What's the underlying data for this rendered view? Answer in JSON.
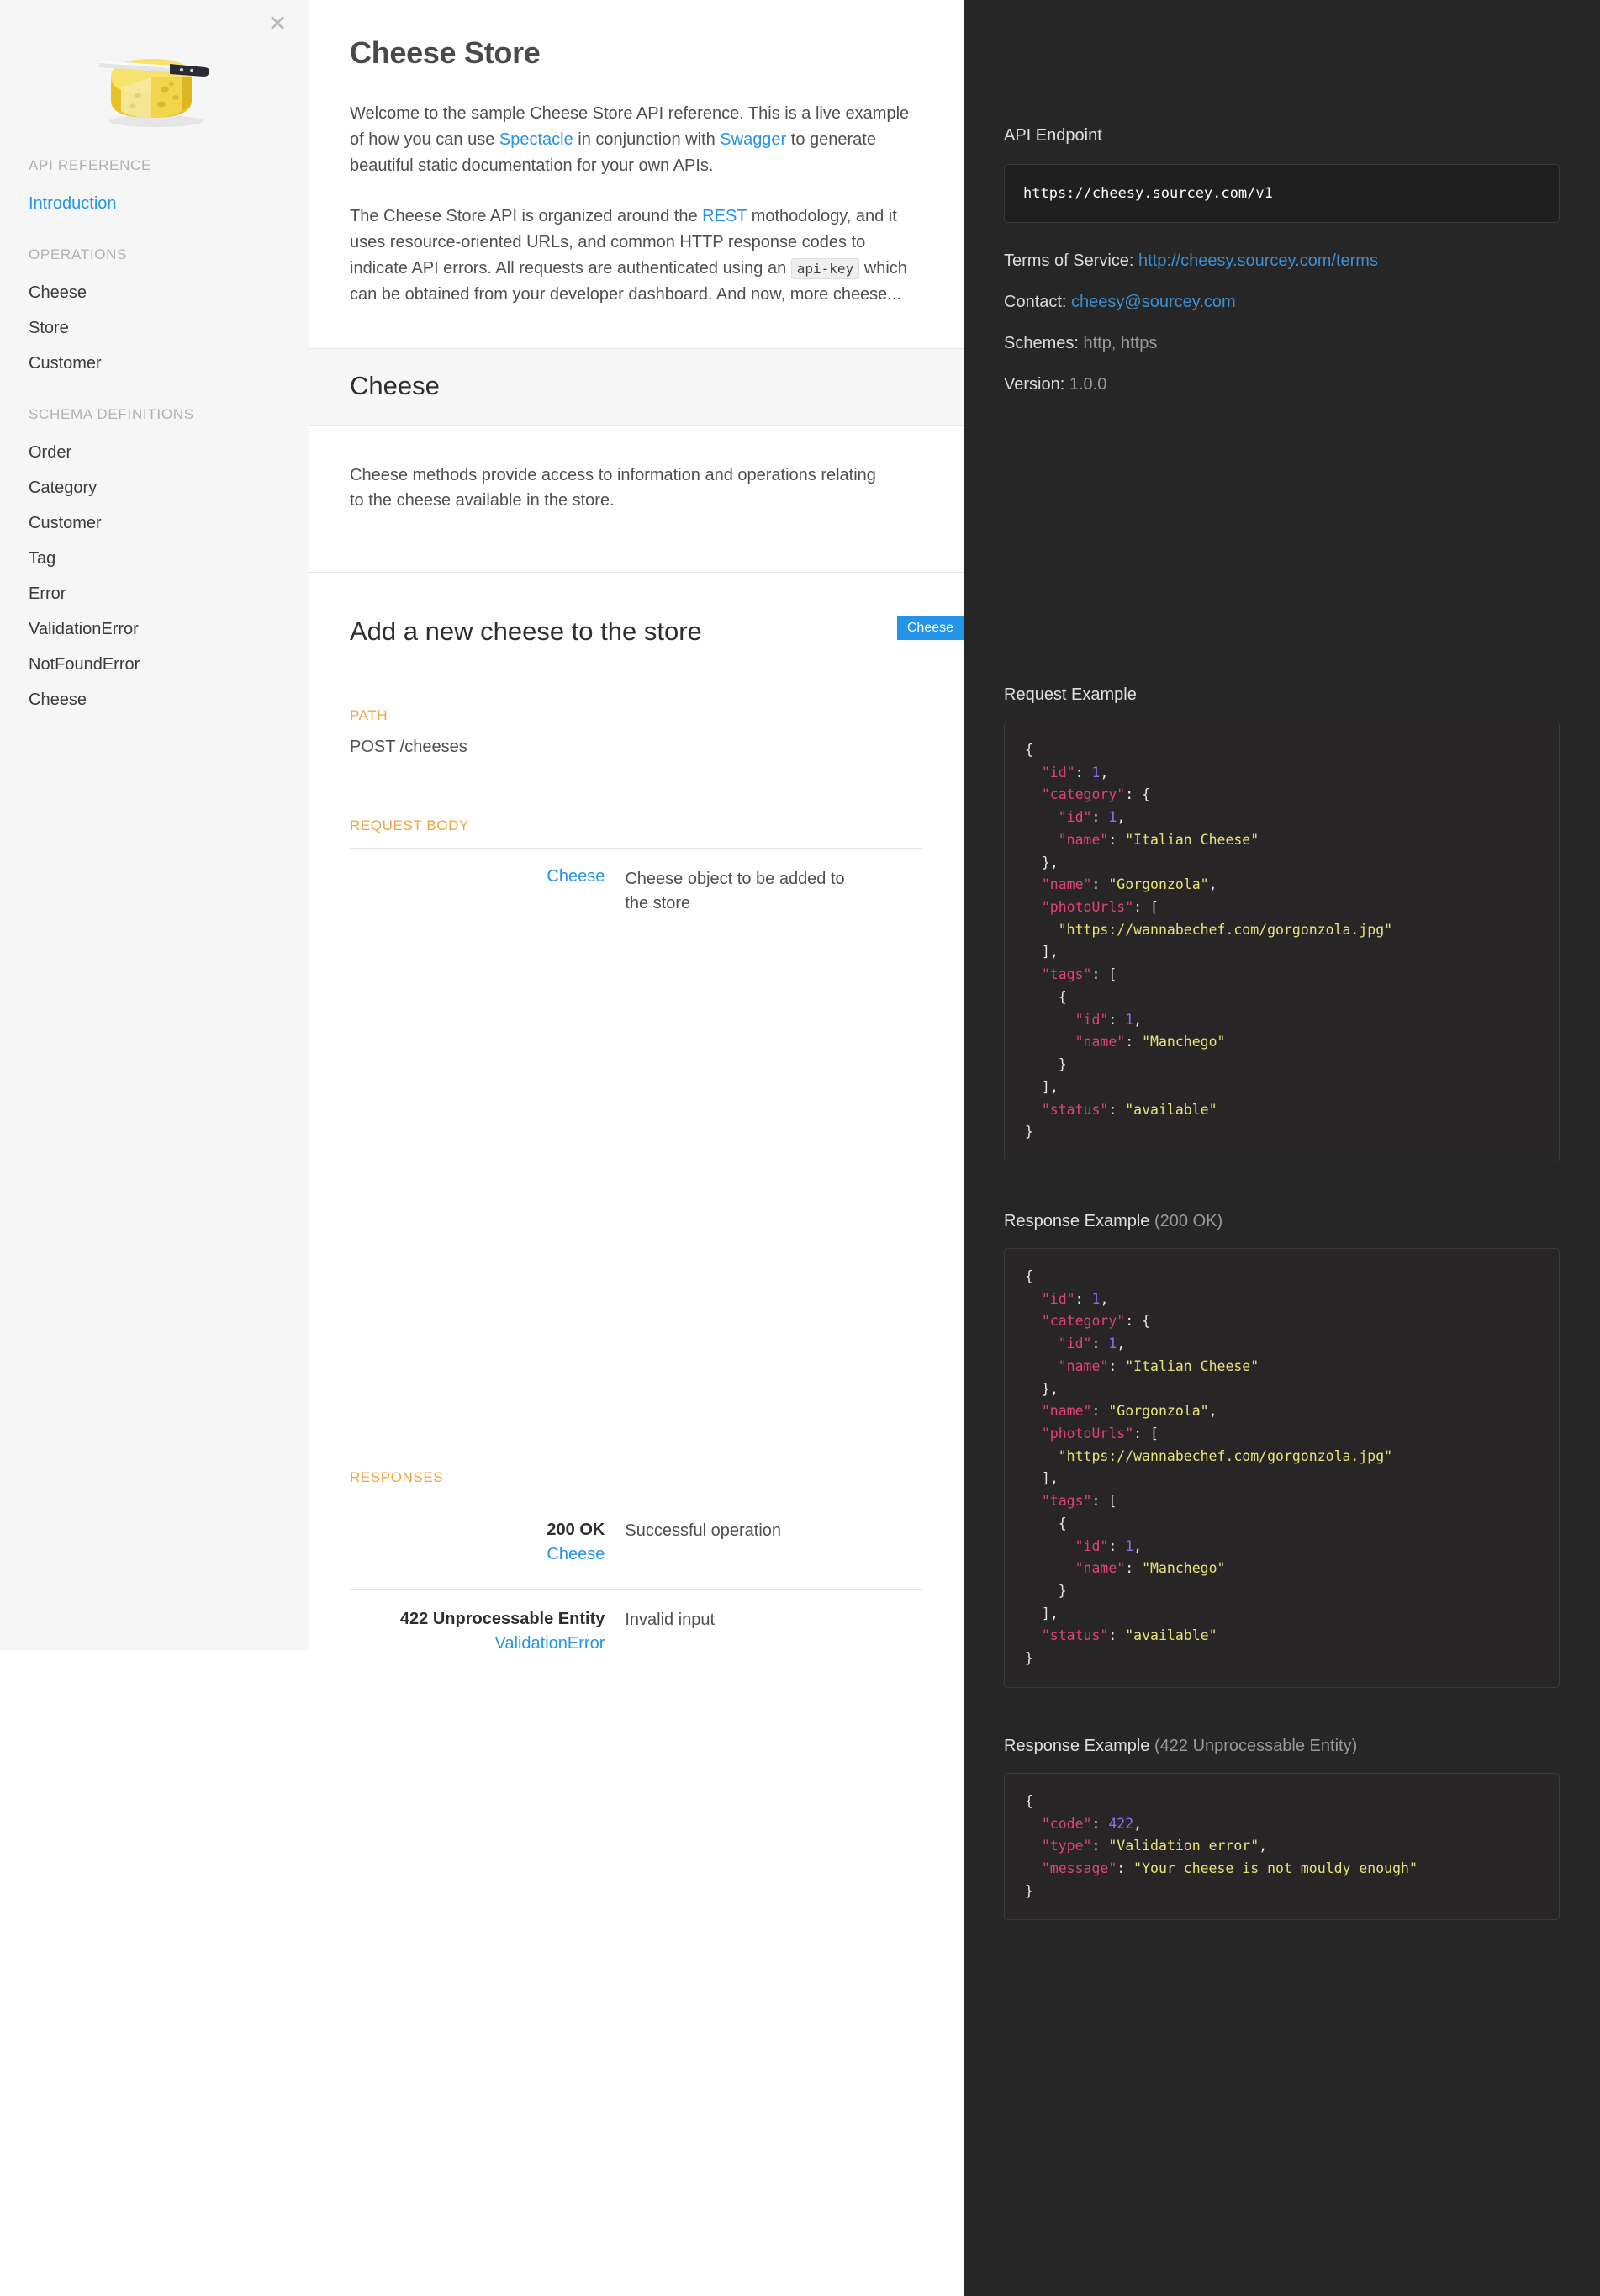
{
  "sidebar": {
    "close_icon": "close-icon",
    "logo_alt": "cheese-wheel-with-knife-logo",
    "groups": [
      {
        "heading": "API REFERENCE",
        "items": [
          {
            "label": "Introduction",
            "active": true
          }
        ]
      },
      {
        "heading": "OPERATIONS",
        "items": [
          {
            "label": "Cheese",
            "active": false
          },
          {
            "label": "Store",
            "active": false
          },
          {
            "label": "Customer",
            "active": false
          }
        ]
      },
      {
        "heading": "SCHEMA DEFINITIONS",
        "items": [
          {
            "label": "Order",
            "active": false
          },
          {
            "label": "Category",
            "active": false
          },
          {
            "label": "Customer",
            "active": false
          },
          {
            "label": "Tag",
            "active": false
          },
          {
            "label": "Error",
            "active": false
          },
          {
            "label": "ValidationError",
            "active": false
          },
          {
            "label": "NotFoundError",
            "active": false
          },
          {
            "label": "Cheese",
            "active": false
          }
        ]
      }
    ]
  },
  "main": {
    "title": "Cheese Store",
    "intro_p1": {
      "t1": "Welcome to the sample Cheese Store API reference. This is a live example of how you can use ",
      "link1": "Spectacle",
      "t2": " in conjunction with ",
      "link2": "Swagger",
      "t3": " to generate beautiful static documentation for your own APIs."
    },
    "intro_p2": {
      "t1": "The Cheese Store API is organized around the ",
      "link1": "REST",
      "t2": " mothodology, and it uses resource-oriented URLs, and common HTTP response codes to indicate API errors. All requests are authenticated using an ",
      "code1": "api-key",
      "t3": " which can be obtained from your developer dashboard. And now, more cheese..."
    },
    "section": {
      "heading": "Cheese",
      "description": "Cheese methods provide access to information and operations relating to the cheese available in the store."
    },
    "operation": {
      "tag": "Cheese",
      "title": "Add a new cheese to the store",
      "path_label": "PATH",
      "path_value": "POST /cheeses",
      "request_body_label": "REQUEST BODY",
      "request_body_rows": [
        {
          "key_link": "Cheese",
          "value": "Cheese object to be added to the store"
        }
      ],
      "responses_label": "RESPONSES",
      "responses": [
        {
          "status": "200 OK",
          "schema": "Cheese",
          "description": "Successful operation"
        },
        {
          "status": "422 Unprocessable Entity",
          "schema": "ValidationError",
          "description": "Invalid input"
        }
      ]
    }
  },
  "panel": {
    "endpoint_label": "API Endpoint",
    "endpoint_url": "https://cheesy.sourcey.com/v1",
    "terms_label": "Terms of Service:",
    "terms_value": "http://cheesy.sourcey.com/terms",
    "contact_label": "Contact:",
    "contact_value": "cheesy@sourcey.com",
    "schemes_label": "Schemes:",
    "schemes_value": "http, https",
    "version_label": "Version:",
    "version_value": "1.0.0",
    "request_example_label": "Request Example",
    "response_200_label": "Response Example",
    "response_200_status": "(200 OK)",
    "response_422_label": "Response Example",
    "response_422_status": "(422 Unprocessable Entity)",
    "request_example_json": {
      "id": 1,
      "category": {
        "id": 1,
        "name": "Italian Cheese"
      },
      "name": "Gorgonzola",
      "photoUrls": [
        "https://wannabechef.com/gorgonzola.jpg"
      ],
      "tags": [
        {
          "id": 1,
          "name": "Manchego"
        }
      ],
      "status": "available"
    },
    "response_200_json": {
      "id": 1,
      "category": {
        "id": 1,
        "name": "Italian Cheese"
      },
      "name": "Gorgonzola",
      "photoUrls": [
        "https://wannabechef.com/gorgonzola.jpg"
      ],
      "tags": [
        {
          "id": 1,
          "name": "Manchego"
        }
      ],
      "status": "available"
    },
    "response_422_json": {
      "code": 422,
      "type": "Validation error",
      "message": "Your cheese is not mouldy enough"
    }
  },
  "colors": {
    "accent_blue": "#2494e8",
    "label_orange": "#f2a33c",
    "panel_bg": "#262626",
    "sidebar_bg": "#f6f6f6",
    "json_key": "#e0437a",
    "json_string": "#e8e47c",
    "json_number": "#8f6fe8"
  }
}
